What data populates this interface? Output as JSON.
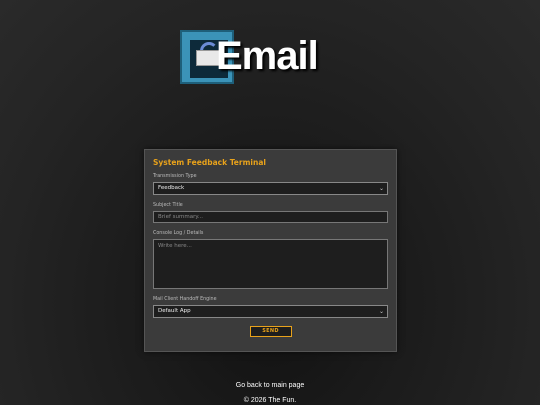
{
  "logo": {
    "text": "Email"
  },
  "panel": {
    "title": "System Feedback Terminal",
    "transmission": {
      "label": "Transmission Type",
      "value": "Feedback"
    },
    "subject": {
      "label": "Subject Title",
      "placeholder": "Brief summary..."
    },
    "console": {
      "label": "Console Log / Details",
      "placeholder": "Write here..."
    },
    "handoff": {
      "label": "Mail Client Handoff Engine",
      "value": "Default App"
    },
    "send_label": "SEND"
  },
  "back_link": "Go back to main page",
  "footer": "© 2026 The Fun.",
  "colors": {
    "accent": "#e8a21b",
    "panel": "#3b3b3b",
    "logo_blue": "#3b93b8"
  }
}
